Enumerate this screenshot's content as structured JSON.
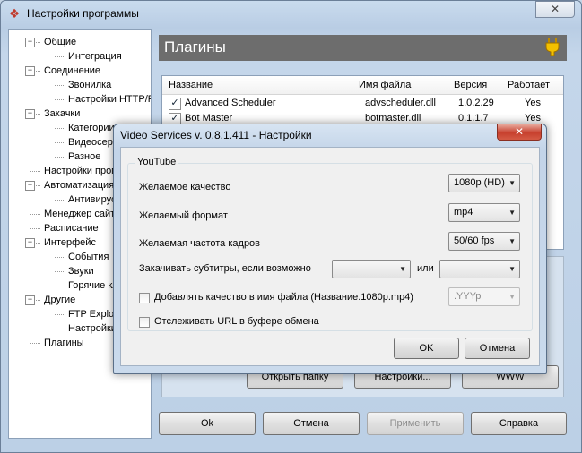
{
  "window": {
    "title": "Настройки программы",
    "close_label": "✕"
  },
  "tree": {
    "items": [
      {
        "label": "Общие"
      },
      {
        "label": "Интеграция"
      },
      {
        "label": "Соединение"
      },
      {
        "label": "Звонилка"
      },
      {
        "label": "Настройки HTTP/FTP"
      },
      {
        "label": "Закачки"
      },
      {
        "label": "Категории"
      },
      {
        "label": "Видеосервисы"
      },
      {
        "label": "Разное"
      },
      {
        "label": "Настройки программы"
      },
      {
        "label": "Автоматизация"
      },
      {
        "label": "Антивирус"
      },
      {
        "label": "Менеджер сайтов"
      },
      {
        "label": "Расписание"
      },
      {
        "label": "Интерфейс"
      },
      {
        "label": "События"
      },
      {
        "label": "Звуки"
      },
      {
        "label": "Горячие клавиши"
      },
      {
        "label": "Другие"
      },
      {
        "label": "FTP Explorer"
      },
      {
        "label": "Настройки"
      },
      {
        "label": "Плагины"
      }
    ]
  },
  "panel": {
    "title": "Плагины",
    "icon": "plug-icon",
    "table": {
      "headers": [
        "Название",
        "Имя файла",
        "Версия",
        "Работает"
      ],
      "rows": [
        {
          "name": "Advanced Scheduler",
          "file": "advscheduler.dll",
          "version": "1.0.2.29",
          "works": "Yes",
          "checked": true
        },
        {
          "name": "Bot Master",
          "file": "botmaster.dll",
          "version": "0.1.1.7",
          "works": "Yes",
          "checked": true
        }
      ]
    },
    "hidden_buttons": {
      "open": "Открыть папку",
      "settings": "Настройки...",
      "www": "WWW"
    }
  },
  "footer": {
    "ok": "Ok",
    "cancel": "Отмена",
    "apply": "Применить",
    "help": "Справка"
  },
  "dialog": {
    "title": "Video Services v. 0.8.1.411 - Настройки",
    "close_label": "✕",
    "group_title": "YouTube",
    "quality_label": "Желаемое качество",
    "quality_value": "1080p (HD)",
    "format_label": "Желаемый формат",
    "format_value": "mp4",
    "fps_label": "Желаемая частота кадров",
    "fps_value": "50/60 fps",
    "subtitles_label": "Закачивать субтитры, если возможно",
    "subtitles_value": "",
    "or_label": "или",
    "subtitles_alt_value": "",
    "add_quality_label": "Добавлять качество в имя файла  (Название.1080p.mp4)",
    "add_quality_value": ".YYYp",
    "track_url_label": "Отслеживать URL в буфере обмена",
    "ok": "OK",
    "cancel": "Отмена"
  },
  "colors": {
    "header_bg": "#6d6d6d",
    "window_frame": "#c6d5e6",
    "close_red": "#c7402e"
  }
}
